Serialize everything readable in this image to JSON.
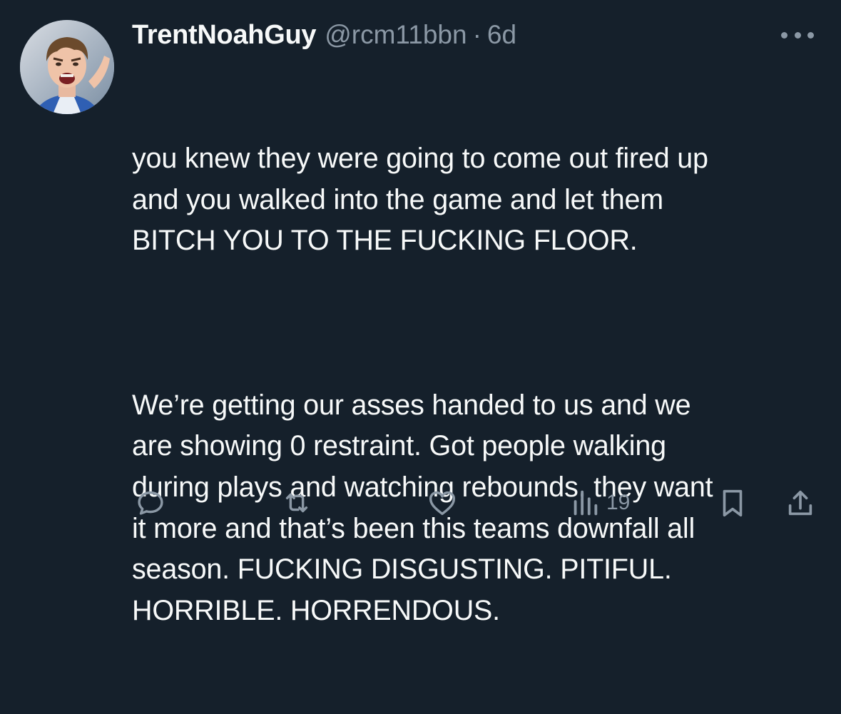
{
  "tweet": {
    "display_name": "TrentNoahGuy",
    "handle": "@rcm11bbn",
    "separator": "·",
    "time": "6d",
    "paragraph1": "you knew they were going to come out fired up\nand you walked into the game and let them\nBITCH YOU TO THE FUCKING FLOOR.",
    "paragraph2": "We’re getting our asses handed to us and we\nare showing 0 restraint. Got people walking\nduring plays and watching rebounds, they want\nit more and that’s been this teams downfall all\nseason. FUCKING DISGUSTING. PITIFUL.\nHORRIBLE. HORRENDOUS."
  },
  "actions": {
    "views_count": "19"
  },
  "icons": {
    "reply": "reply-icon",
    "retweet": "retweet-icon",
    "like": "heart-icon",
    "views": "views-chart-icon",
    "bookmark": "bookmark-icon",
    "share": "share-icon",
    "more": "more-dots-icon"
  },
  "colors": {
    "background": "#15202b",
    "primary_text": "#f7f9f9",
    "secondary_text": "#8b98a5"
  }
}
